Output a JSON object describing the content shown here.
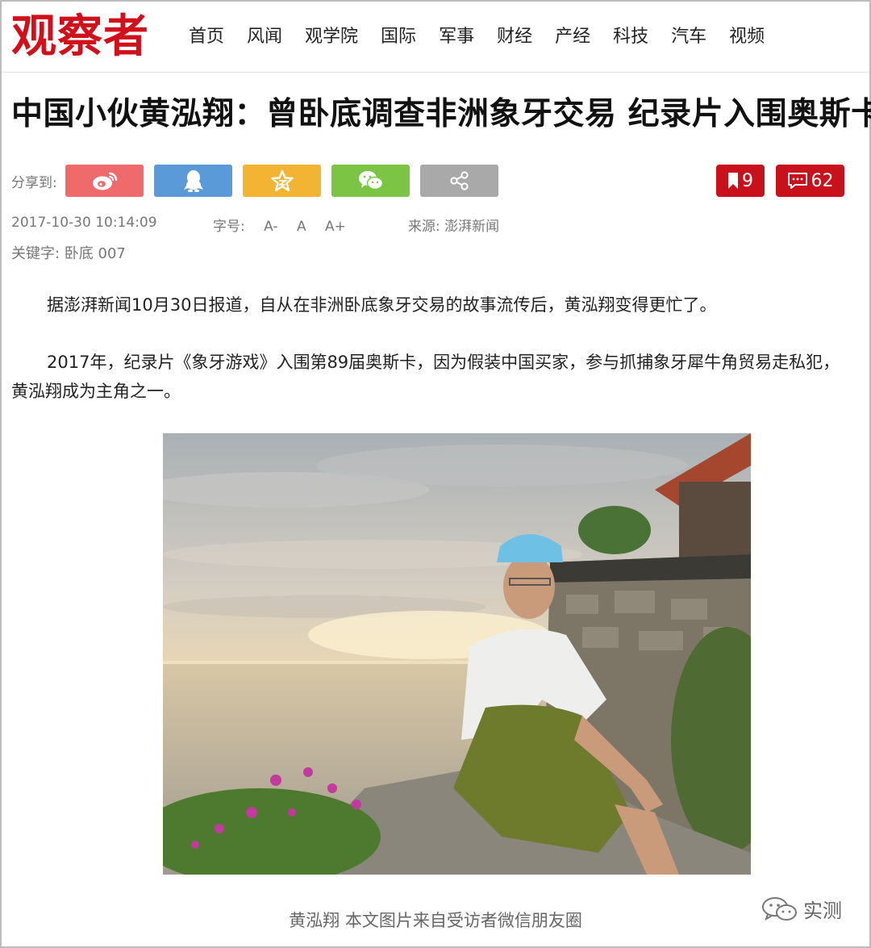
{
  "header": {
    "logo": "观察者",
    "nav": [
      "首页",
      "风闻",
      "观学院",
      "国际",
      "军事",
      "财经",
      "产经",
      "科技",
      "汽车",
      "视频"
    ]
  },
  "article": {
    "title": "中国小伙黄泓翔：曾卧底调查非洲象牙交易 纪录片入围奥斯卡",
    "share_label": "分享到:",
    "share_icons": [
      "weibo-icon",
      "qq-icon",
      "qzone-star-icon",
      "wechat-icon",
      "share-icon"
    ],
    "bookmark_count": "9",
    "comment_count": "62",
    "date": "2017-10-30 10:14:09",
    "fontsize_label": "字号:",
    "fontsize_options": [
      "A-",
      "A",
      "A+"
    ],
    "source": "来源: 澎湃新闻",
    "keywords": "关键字: 卧底 007",
    "paragraphs": [
      "据澎湃新闻10月30日报道，自从在非洲卧底象牙交易的故事流传后，黄泓翔变得更忙了。",
      "2017年，纪录片《象牙游戏》入围第89届奥斯卡，因为假装中国买家，参与抓捕象牙犀牛角贸易走私犯，黄泓翔成为主角之一。"
    ],
    "caption": "黄泓翔  本文图片来自受访者微信朋友圈"
  },
  "watermark": {
    "text": "实测"
  },
  "colors": {
    "brand_red": "#c8111b",
    "weibo": "#ef6a6a",
    "qq": "#5b9ad8",
    "qzone": "#f2b432",
    "wechat": "#7cc544",
    "more": "#a9a9a9"
  }
}
